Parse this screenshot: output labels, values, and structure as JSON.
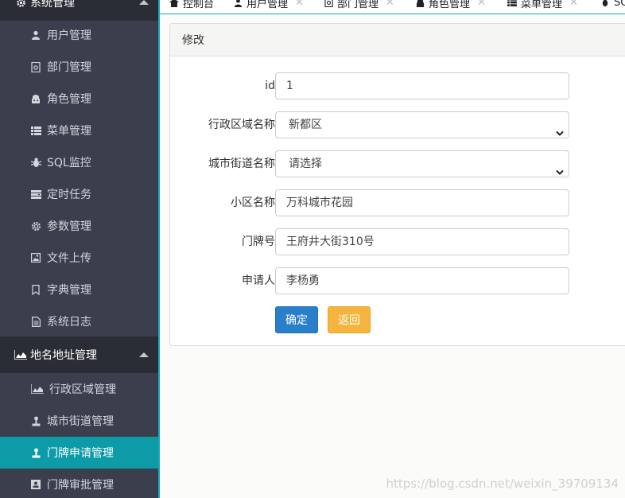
{
  "sidebar": {
    "group_system": "系统管理",
    "system_items": [
      {
        "label": "用户管理",
        "icon": "user-icon"
      },
      {
        "label": "部门管理",
        "icon": "department-icon"
      },
      {
        "label": "角色管理",
        "icon": "role-icon"
      },
      {
        "label": "菜单管理",
        "icon": "menu-list-icon"
      },
      {
        "label": "SQL监控",
        "icon": "bug-icon"
      },
      {
        "label": "定时任务",
        "icon": "task-icon"
      },
      {
        "label": "参数管理",
        "icon": "settings-icon"
      },
      {
        "label": "文件上传",
        "icon": "image-icon"
      },
      {
        "label": "字典管理",
        "icon": "bookmark-icon"
      },
      {
        "label": "系统日志",
        "icon": "document-icon"
      }
    ],
    "group_address": "地名地址管理",
    "address_items": [
      {
        "label": "行政区域管理",
        "icon": "area-chart-icon"
      },
      {
        "label": "城市街道管理",
        "icon": "street-icon"
      },
      {
        "label": "门牌申请管理",
        "icon": "doorplate-icon",
        "active": true
      },
      {
        "label": "门牌审批管理",
        "icon": "approval-icon"
      }
    ]
  },
  "tabs": [
    {
      "label": "控制台",
      "icon": "home-icon"
    },
    {
      "label": "用户管理",
      "icon": "user-icon"
    },
    {
      "label": "部门管理",
      "icon": "department-icon"
    },
    {
      "label": "角色管理",
      "icon": "role-icon"
    },
    {
      "label": "菜单管理",
      "icon": "menu-list-icon"
    },
    {
      "label": "SQ",
      "icon": "bug-icon"
    }
  ],
  "panel": {
    "title": "修改",
    "fields": [
      {
        "label": "id",
        "value": "1",
        "type": "input"
      },
      {
        "label": "行政区域名称",
        "value": "新都区",
        "type": "select"
      },
      {
        "label": "城市街道名称",
        "value": "请选择",
        "type": "select"
      },
      {
        "label": "小区名称",
        "value": "万科城市花园",
        "type": "input"
      },
      {
        "label": "门牌号",
        "value": "王府井大街310号",
        "type": "input"
      },
      {
        "label": "申请人",
        "value": "李杨勇",
        "type": "input"
      }
    ],
    "ok_label": "确定",
    "back_label": "返回"
  },
  "watermark": "https://blog.csdn.net/weixin_39709134",
  "colors": {
    "sidebar_bg": "#3b3e4d",
    "group_bg": "#2a2c36",
    "active_bg": "#0d9ba8",
    "primary": "#2a7fca",
    "warning": "#f5b43d"
  }
}
